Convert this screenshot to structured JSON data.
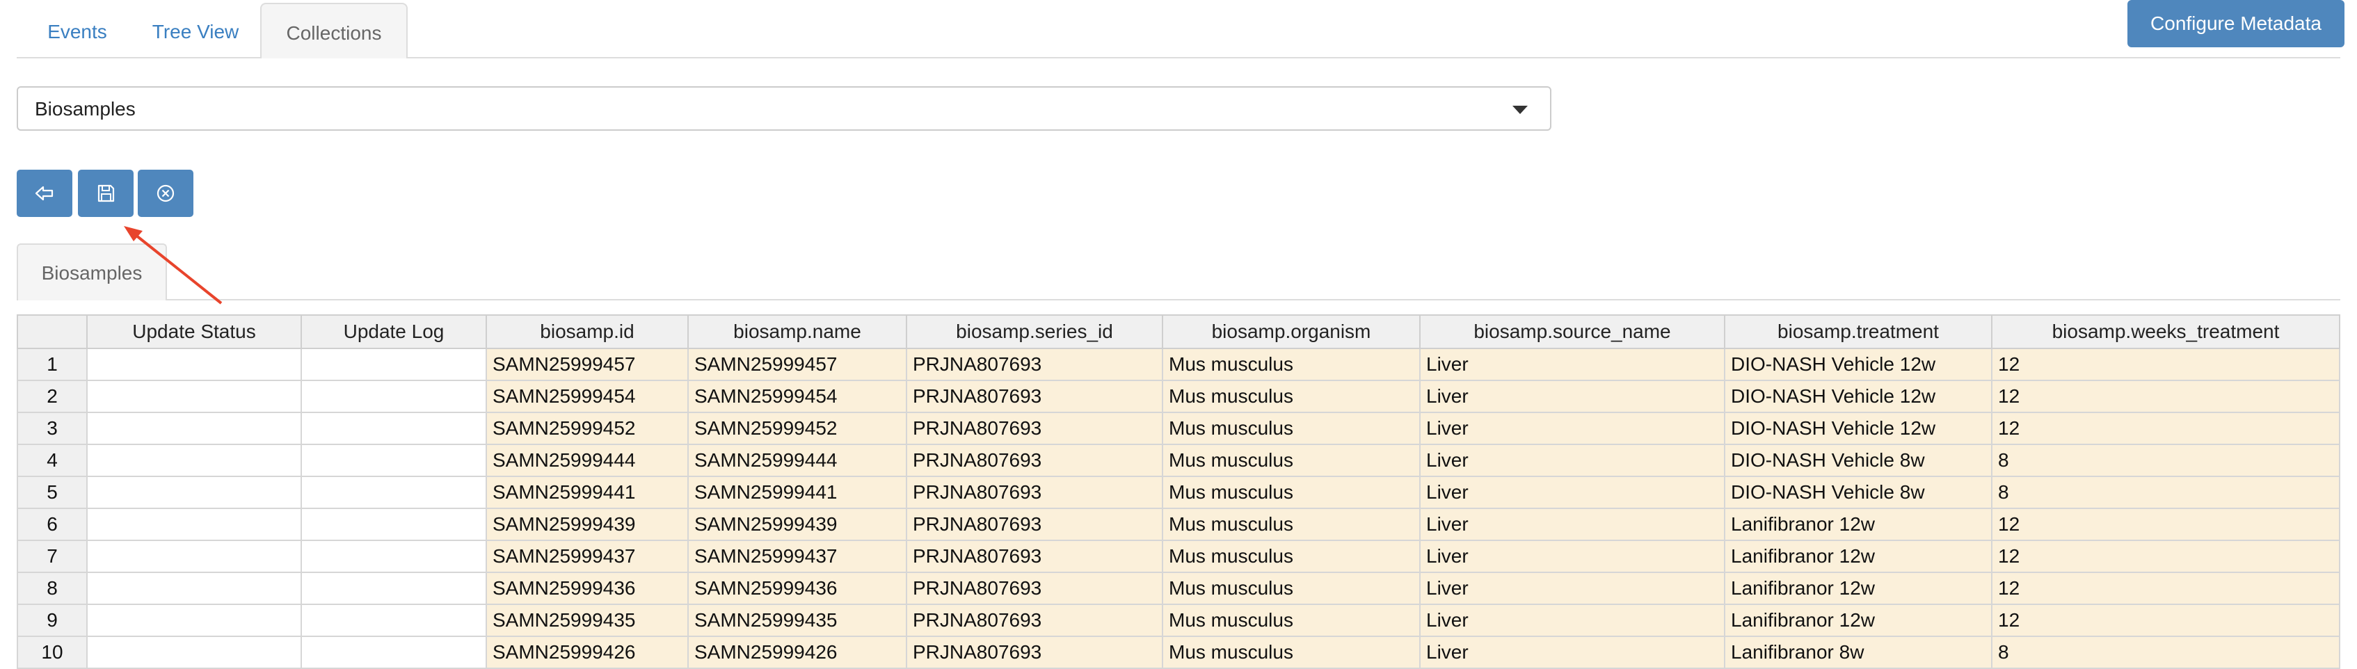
{
  "tabs": [
    {
      "label": "Events"
    },
    {
      "label": "Tree View"
    },
    {
      "label": "Collections"
    }
  ],
  "active_tab": "Collections",
  "header": {
    "configure_metadata_label": "Configure Metadata"
  },
  "collection_select": {
    "value": "Biosamples"
  },
  "toolbar": {
    "buttons": [
      {
        "icon": "back-arrow-icon"
      },
      {
        "icon": "save-icon"
      },
      {
        "icon": "cancel-circle-icon"
      }
    ]
  },
  "subtab": {
    "label": "Biosamples"
  },
  "annotation": {
    "color": "#e8442c",
    "points_to": "save-button"
  },
  "colors": {
    "accent": "#4f87bd",
    "edited_cell": "#fbf0da",
    "header_bg": "#f0f0f0"
  },
  "table": {
    "columns": [
      "",
      "Update Status",
      "Update Log",
      "biosamp.id",
      "biosamp.name",
      "biosamp.series_id",
      "biosamp.organism",
      "biosamp.source_name",
      "biosamp.treatment",
      "biosamp.weeks_treatment"
    ],
    "rows": [
      [
        "1",
        "",
        "",
        "SAMN25999457",
        "SAMN25999457",
        "PRJNA807693",
        "Mus musculus",
        "Liver",
        "DIO-NASH Vehicle 12w",
        "12"
      ],
      [
        "2",
        "",
        "",
        "SAMN25999454",
        "SAMN25999454",
        "PRJNA807693",
        "Mus musculus",
        "Liver",
        "DIO-NASH Vehicle 12w",
        "12"
      ],
      [
        "3",
        "",
        "",
        "SAMN25999452",
        "SAMN25999452",
        "PRJNA807693",
        "Mus musculus",
        "Liver",
        "DIO-NASH Vehicle 12w",
        "12"
      ],
      [
        "4",
        "",
        "",
        "SAMN25999444",
        "SAMN25999444",
        "PRJNA807693",
        "Mus musculus",
        "Liver",
        "DIO-NASH Vehicle 8w",
        "8"
      ],
      [
        "5",
        "",
        "",
        "SAMN25999441",
        "SAMN25999441",
        "PRJNA807693",
        "Mus musculus",
        "Liver",
        "DIO-NASH Vehicle 8w",
        "8"
      ],
      [
        "6",
        "",
        "",
        "SAMN25999439",
        "SAMN25999439",
        "PRJNA807693",
        "Mus musculus",
        "Liver",
        "Lanifibranor 12w",
        "12"
      ],
      [
        "7",
        "",
        "",
        "SAMN25999437",
        "SAMN25999437",
        "PRJNA807693",
        "Mus musculus",
        "Liver",
        "Lanifibranor 12w",
        "12"
      ],
      [
        "8",
        "",
        "",
        "SAMN25999436",
        "SAMN25999436",
        "PRJNA807693",
        "Mus musculus",
        "Liver",
        "Lanifibranor 12w",
        "12"
      ],
      [
        "9",
        "",
        "",
        "SAMN25999435",
        "SAMN25999435",
        "PRJNA807693",
        "Mus musculus",
        "Liver",
        "Lanifibranor 12w",
        "12"
      ],
      [
        "10",
        "",
        "",
        "SAMN25999426",
        "SAMN25999426",
        "PRJNA807693",
        "Mus musculus",
        "Liver",
        "Lanifibranor 8w",
        "8"
      ]
    ]
  }
}
